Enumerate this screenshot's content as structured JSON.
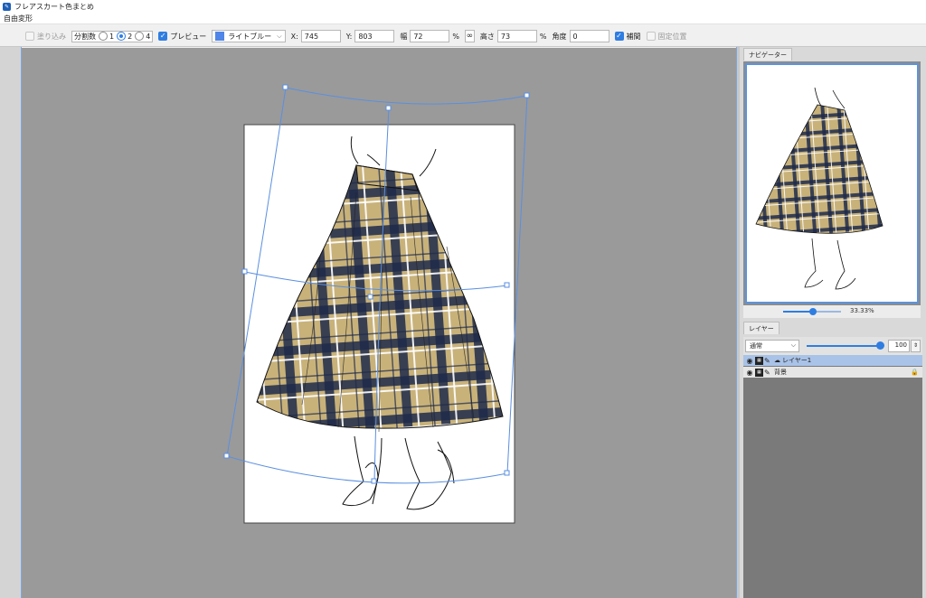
{
  "window": {
    "title": "フレアスカート色まとめ"
  },
  "menu": {
    "items": [
      "自由変形"
    ]
  },
  "toolbar": {
    "fill_label": "塗り込み",
    "divisions_label": "分割数",
    "div_1": "1",
    "div_2": "2",
    "div_4": "4",
    "preview_label": "プレビュー",
    "color_select": "ライトブルー",
    "x_label": "X:",
    "x_value": "745",
    "y_label": "Y:",
    "y_value": "803",
    "width_label": "幅",
    "width_value": "72",
    "width_unit": "%",
    "height_label": "高さ",
    "height_value": "73",
    "height_unit": "%",
    "angle_label": "角度",
    "angle_value": "0",
    "interp_label": "補間",
    "fixed_label": "固定位置",
    "accent_color": "#2f7de1",
    "swatch_color": "#4f86e8"
  },
  "navigator": {
    "tab": "ナビゲーター",
    "zoom": "33.33%"
  },
  "layers": {
    "tab": "レイヤー",
    "blend_mode": "通常",
    "opacity": "100",
    "opacity_level": 1.0,
    "items": [
      {
        "name": "レイヤー1",
        "selected": true
      },
      {
        "name": "背景",
        "locked": true
      }
    ]
  },
  "colors": {
    "skirt_base": "#c8b27a",
    "plaid_dark": "#1e2a4a",
    "canvas_bg": "#9a9a9a",
    "handle": "#4f86e8"
  }
}
